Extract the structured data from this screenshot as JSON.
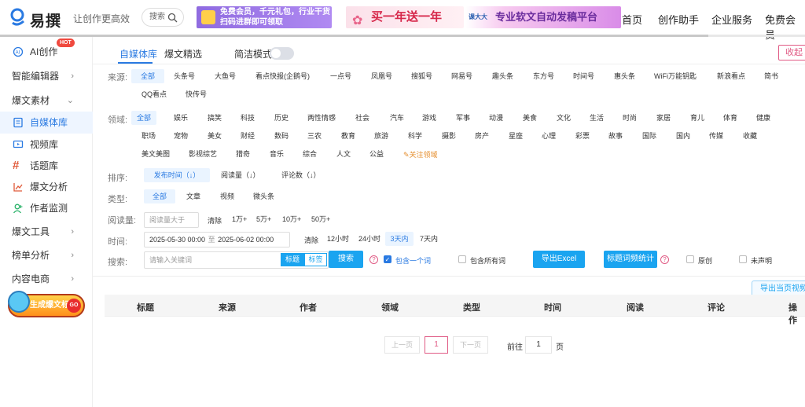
{
  "header": {
    "logo_text": "易撰",
    "slogan": "让创作更高效",
    "search_label": "搜索",
    "banners": [
      {
        "text_line1": "免费会员，千元礼包，行业干货",
        "text_line2": "扫码进群即可领取"
      },
      {
        "text": "买一年送一年"
      },
      {
        "brand": "课大大",
        "text": "专业软文自动发稿平台"
      }
    ],
    "nav": [
      "首页",
      "创作助手",
      "企业服务",
      "免费会员"
    ],
    "progress_fraction": 0.88
  },
  "sidebar": {
    "ai_label": "AI创作",
    "hot_badge": "HOT",
    "editor_label": "智能编辑器",
    "material_label": "爆文素材",
    "sub_items": [
      "自媒体库",
      "视频库",
      "话题库",
      "爆文分析",
      "作者监测"
    ],
    "tools_label": "爆文工具",
    "ranking_label": "榜单分析",
    "mall_label": "内容电商",
    "gen_button": "生成爆文标题",
    "gen_go": "GO"
  },
  "tabs": {
    "items": [
      "自媒体库",
      "爆文精选"
    ],
    "simple_mode": "简洁模式",
    "collapse": "收起"
  },
  "filters": {
    "source_label": "来源:",
    "sources": [
      "全部",
      "头条号",
      "大鱼号",
      "看点快报(企鹅号)",
      "一点号",
      "凤凰号",
      "搜狐号",
      "网易号",
      "趣头条",
      "东方号",
      "时间号",
      "惠头条",
      "WiFi万能钥匙",
      "新浪看点",
      "简书",
      "QQ看点",
      "快传号"
    ],
    "domain_label": "领域:",
    "domains_row1": [
      "全部",
      "娱乐",
      "搞笑",
      "科技",
      "历史",
      "两性情感",
      "社会",
      "汽车",
      "游戏",
      "军事",
      "动漫",
      "美食",
      "文化",
      "生活",
      "时尚",
      "家居",
      "育儿",
      "体育",
      "健康"
    ],
    "domains_row2": [
      "职场",
      "宠物",
      "美女",
      "财经",
      "数码",
      "三农",
      "教育",
      "旅游",
      "科学",
      "摄影",
      "房产",
      "星座",
      "心理",
      "彩票",
      "故事",
      "国际",
      "国内",
      "传媒",
      "收藏"
    ],
    "domains_row3": [
      "美文美图",
      "影视综艺",
      "猎奇",
      "音乐",
      "综合",
      "人文",
      "公益"
    ],
    "follow_domain": "关注领域",
    "sort_label": "排序:",
    "sort_options": [
      "发布时间（↓）",
      "阅读量（↓）",
      "评论数（↓）"
    ],
    "type_label": "类型:",
    "types": [
      "全部",
      "文章",
      "视频",
      "微头条"
    ],
    "reads_label": "阅读量:",
    "reads_placeholder": "阅读量大于",
    "reads_clear": "清除",
    "reads_options": [
      "1万+",
      "5万+",
      "10万+",
      "50万+"
    ],
    "time_label": "时间:",
    "time_start": "2025-05-30 00:00",
    "time_sep": "至",
    "time_end": "2025-06-02 00:00",
    "time_clear": "清除",
    "time_options": [
      "12小时",
      "24小时",
      "3天内",
      "7天内"
    ],
    "search_label": "搜索:",
    "search_placeholder": "请输入关键词",
    "scope_title": "标题",
    "scope_tag": "标签",
    "search_button": "搜索",
    "contains_one": "包含一个词",
    "contains_all": "包含所有词",
    "export_excel": "导出Excel",
    "title_freq": "标题词频统计",
    "original": "原创",
    "undeclared": "未声明"
  },
  "export_page": "导出当页视频",
  "table": {
    "columns": [
      "标题",
      "来源",
      "作者",
      "领域",
      "类型",
      "时间",
      "阅读",
      "评论",
      "操作"
    ]
  },
  "pagination": {
    "prev": "上一页",
    "current": "1",
    "next": "下一页",
    "goto": "前往",
    "goto_value": "1",
    "page_unit": "页"
  },
  "colors": {
    "accent": "#2a7ae2",
    "pink": "#e05a84",
    "button_blue": "#1aa4f0"
  }
}
